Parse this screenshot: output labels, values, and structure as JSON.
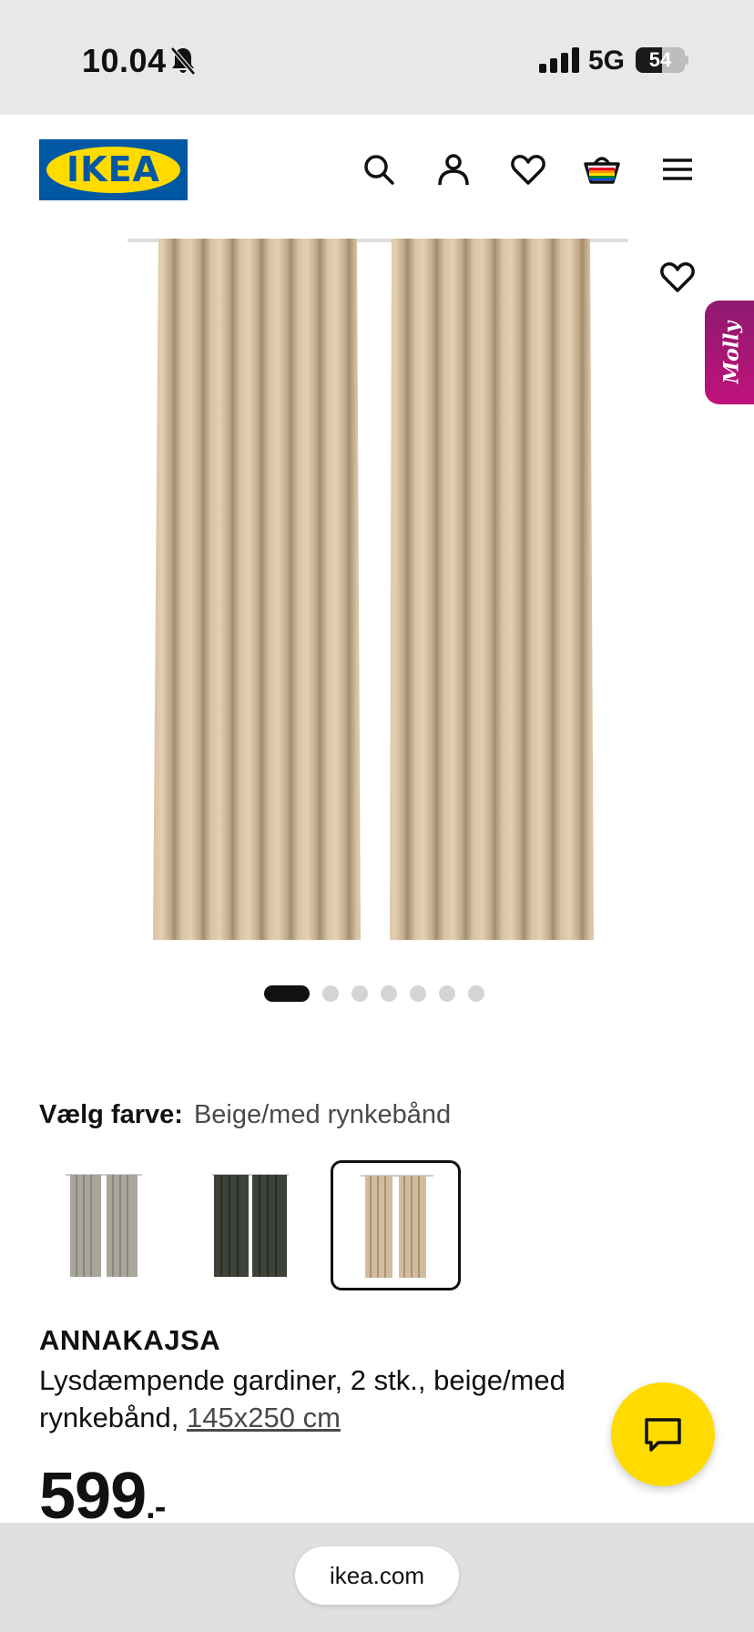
{
  "status_bar": {
    "time": "10.04",
    "network": "5G",
    "battery_percent": "54",
    "battery_level": 0.54,
    "icons": [
      "bell-muted-icon",
      "signal-bars-icon",
      "battery-icon"
    ]
  },
  "header": {
    "logo_text": "IKEA",
    "icons": [
      "search-icon",
      "account-icon",
      "heart-icon",
      "shopping-bag-icon",
      "menu-icon"
    ],
    "colors": {
      "logo_blue": "#0058a3",
      "logo_yellow": "#ffdb00"
    }
  },
  "gallery": {
    "image_count": 7,
    "active_index": 0,
    "molly_label": "Molly"
  },
  "color_picker": {
    "label": "Vælg farve:",
    "value": "Beige/med rynkebånd",
    "swatches": [
      {
        "name": "grey",
        "color": "#a9a69c"
      },
      {
        "name": "dark-green",
        "color": "#3d4238"
      },
      {
        "name": "beige",
        "color": "#d3bc9d",
        "selected": true
      }
    ]
  },
  "product": {
    "name": "ANNAKAJSA",
    "description": "Lysdæmpende gardiner, 2 stk., beige/med rynkebånd,",
    "size": "145x250 cm",
    "price": "599",
    "price_suffix": ".-"
  },
  "chat": {
    "icon": "chat-bubble-icon",
    "color": "#ffdb00"
  },
  "browser": {
    "url": "ikea.com"
  }
}
